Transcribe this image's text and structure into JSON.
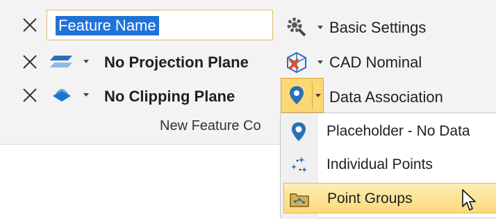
{
  "rows": {
    "feature_name": {
      "value": "Feature Name"
    },
    "projection_plane": {
      "label": "No Projection Plane"
    },
    "clipping_plane": {
      "label": "No Clipping Plane"
    }
  },
  "right_column": {
    "basic_settings": "Basic Settings",
    "cad_nominal": "CAD Nominal",
    "data_association": "Data Association"
  },
  "group_label": "New Feature Co",
  "dropdown": {
    "items": [
      {
        "label": "Placeholder - No Data",
        "icon": "map-pin-icon"
      },
      {
        "label": "Individual Points",
        "icon": "scatter-points-icon"
      },
      {
        "label": "Point Groups",
        "icon": "point-group-icon",
        "highlighted": true
      }
    ]
  },
  "colors": {
    "accent": "#1e73d8",
    "highlight": "#fbd978",
    "warning": "#e04b2a"
  }
}
